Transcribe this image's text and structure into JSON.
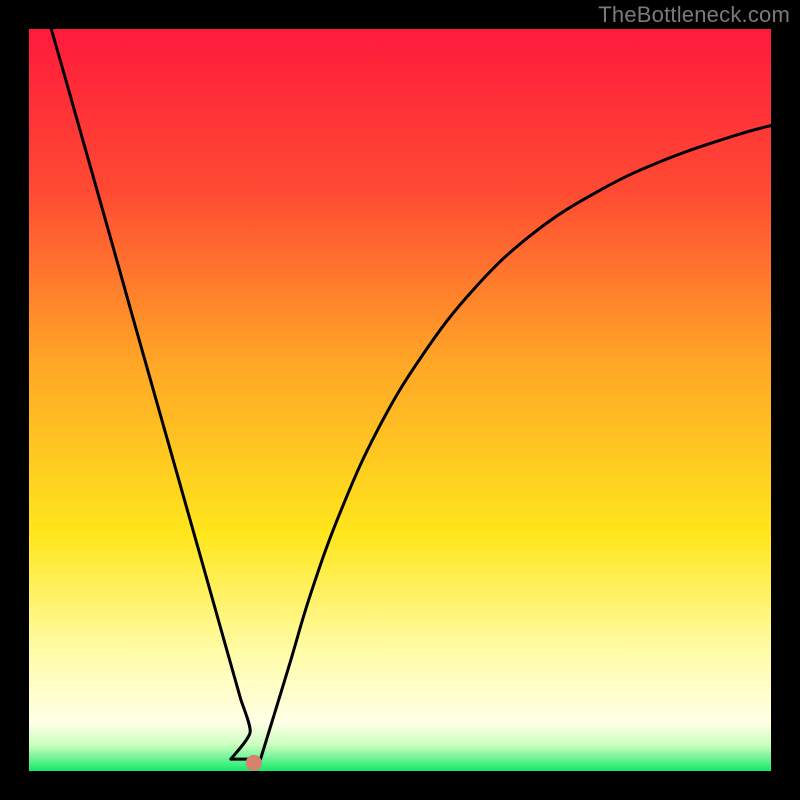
{
  "attribution": "TheBottleneck.com",
  "chart_data": {
    "type": "line",
    "title": "",
    "xlabel": "",
    "ylabel": "",
    "xlim": [
      0,
      100
    ],
    "ylim": [
      0,
      100
    ],
    "gradient_stops": [
      {
        "offset": 0.0,
        "color": "#ff1a3c"
      },
      {
        "offset": 0.22,
        "color": "#ff4b33"
      },
      {
        "offset": 0.45,
        "color": "#ffa626"
      },
      {
        "offset": 0.68,
        "color": "#ffe61c"
      },
      {
        "offset": 0.84,
        "color": "#fffca8"
      },
      {
        "offset": 0.935,
        "color": "#ffffe6"
      },
      {
        "offset": 0.965,
        "color": "#c9ffbe"
      },
      {
        "offset": 1.0,
        "color": "#17e86b"
      }
    ],
    "series": [
      {
        "name": "bottleneck-curve",
        "x": [
          3,
          5,
          8,
          11,
          14,
          17,
          20,
          23,
          25,
          27,
          28.5,
          29.8,
          31.2,
          35,
          38,
          42,
          47,
          53,
          60,
          68,
          77,
          86,
          95,
          100
        ],
        "y": [
          100,
          93,
          82.4,
          71.8,
          61.1,
          50.5,
          39.9,
          29.3,
          22.2,
          15.1,
          9.8,
          5.2,
          1.8,
          14,
          24,
          35,
          46,
          56,
          65,
          72.5,
          78.3,
          82.5,
          85.6,
          87
        ]
      }
    ],
    "flat_bottom": {
      "x_start": 27.2,
      "x_end": 31.2,
      "y": 1.6
    },
    "marker": {
      "x": 30.3,
      "y": 1.1,
      "color": "#d6826f",
      "radius_px": 8
    }
  }
}
